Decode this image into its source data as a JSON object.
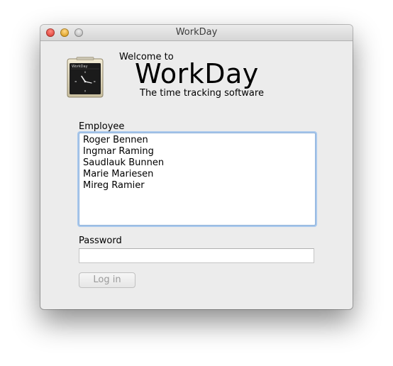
{
  "window": {
    "title": "WorkDay"
  },
  "header": {
    "welcome": "Welcome to",
    "brand": "WorkDay",
    "tagline": "The time tracking software",
    "icon_label": "WorkDay"
  },
  "employee": {
    "label": "Employee",
    "items": [
      "Roger Bennen",
      "Ingmar Raming",
      "Saudlauk Bunnen",
      "Marie Mariesen",
      "Mireg Ramier"
    ]
  },
  "password": {
    "label": "Password",
    "value": ""
  },
  "login": {
    "label": "Log in"
  },
  "colors": {
    "focus_ring": "#8fb2da",
    "window_bg": "#ececec",
    "close": "#e0443c",
    "minimize": "#dea123"
  }
}
